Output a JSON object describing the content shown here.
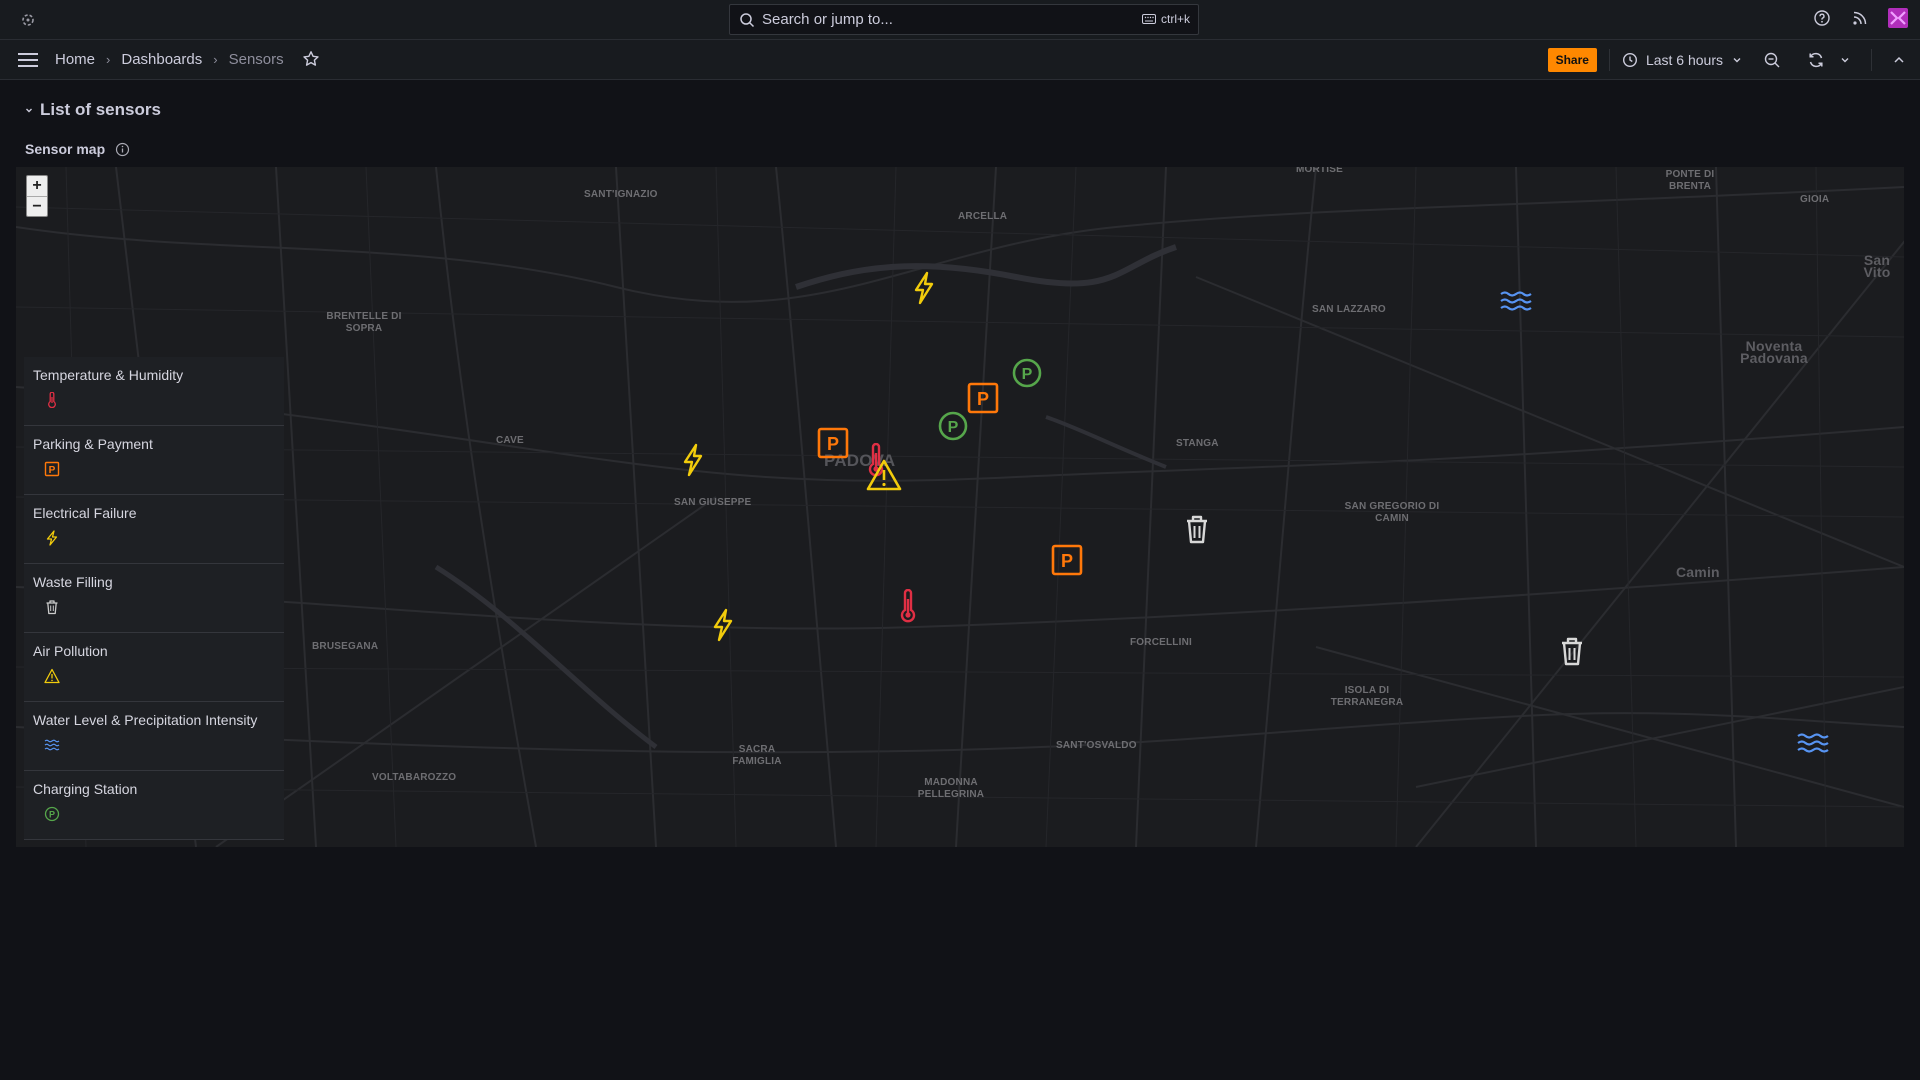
{
  "search": {
    "placeholder": "Search or jump to...",
    "shortcut": "ctrl+k"
  },
  "breadcrumb": [
    "Home",
    "Dashboards",
    "Sensors"
  ],
  "toolbar": {
    "share_label": "Share",
    "time_range": "Last 6 hours"
  },
  "row": {
    "title": "List of sensors"
  },
  "panel": {
    "title": "Sensor map"
  },
  "map": {
    "zoom_in": "+",
    "zoom_out": "−",
    "labels": {
      "santignazio": "SANT'IGNAZIO",
      "arcella": "ARCELLA",
      "mortise": "MORTISE",
      "ponte_di_brenta": "PONTE DI BRENTA",
      "gioia": "GIOIA",
      "san_vito": "San Vito",
      "brentelle": "BRENTELLE DI SOPRA",
      "san_lazzaro": "SAN LAZZARO",
      "noventa": "Noventa Padovana",
      "cave": "CAVE",
      "stanga": "STANGA",
      "padova": "PADOVA",
      "san_giuseppe": "SAN GIUSEPPE",
      "san_gregorio": "SAN GREGORIO DI CAMIN",
      "camin": "Camin",
      "brusegana": "BRUSEGANA",
      "forcellini": "FORCELLINI",
      "isola": "ISOLA DI TERRANEGRA",
      "sacra_famiglia": "SACRA FAMIGLIA",
      "sant_osvaldo": "SANT'OSVALDO",
      "madonna": "MADONNA PELLEGRINA",
      "voltabarozzo": "VOLTABAROZZO"
    }
  },
  "legend": [
    {
      "label": "Temperature & Humidity",
      "icon": "thermometer-icon",
      "color": "#e02f44"
    },
    {
      "label": "Parking & Payment",
      "icon": "parking-icon",
      "color": "#ff780a"
    },
    {
      "label": "Electrical Failure",
      "icon": "lightning-icon",
      "color": "#f2cc0c"
    },
    {
      "label": "Waste Filling",
      "icon": "trash-icon",
      "color": "#cccccc"
    },
    {
      "label": "Air Pollution",
      "icon": "warning-icon",
      "color": "#f2cc0c"
    },
    {
      "label": "Water Level & Precipitation Intensity",
      "icon": "waves-icon",
      "color": "#5794f2"
    },
    {
      "label": "Charging Station",
      "icon": "charging-icon",
      "color": "#56a64b"
    }
  ],
  "colors": {
    "accent": "#ff8800",
    "background": "#111217"
  }
}
